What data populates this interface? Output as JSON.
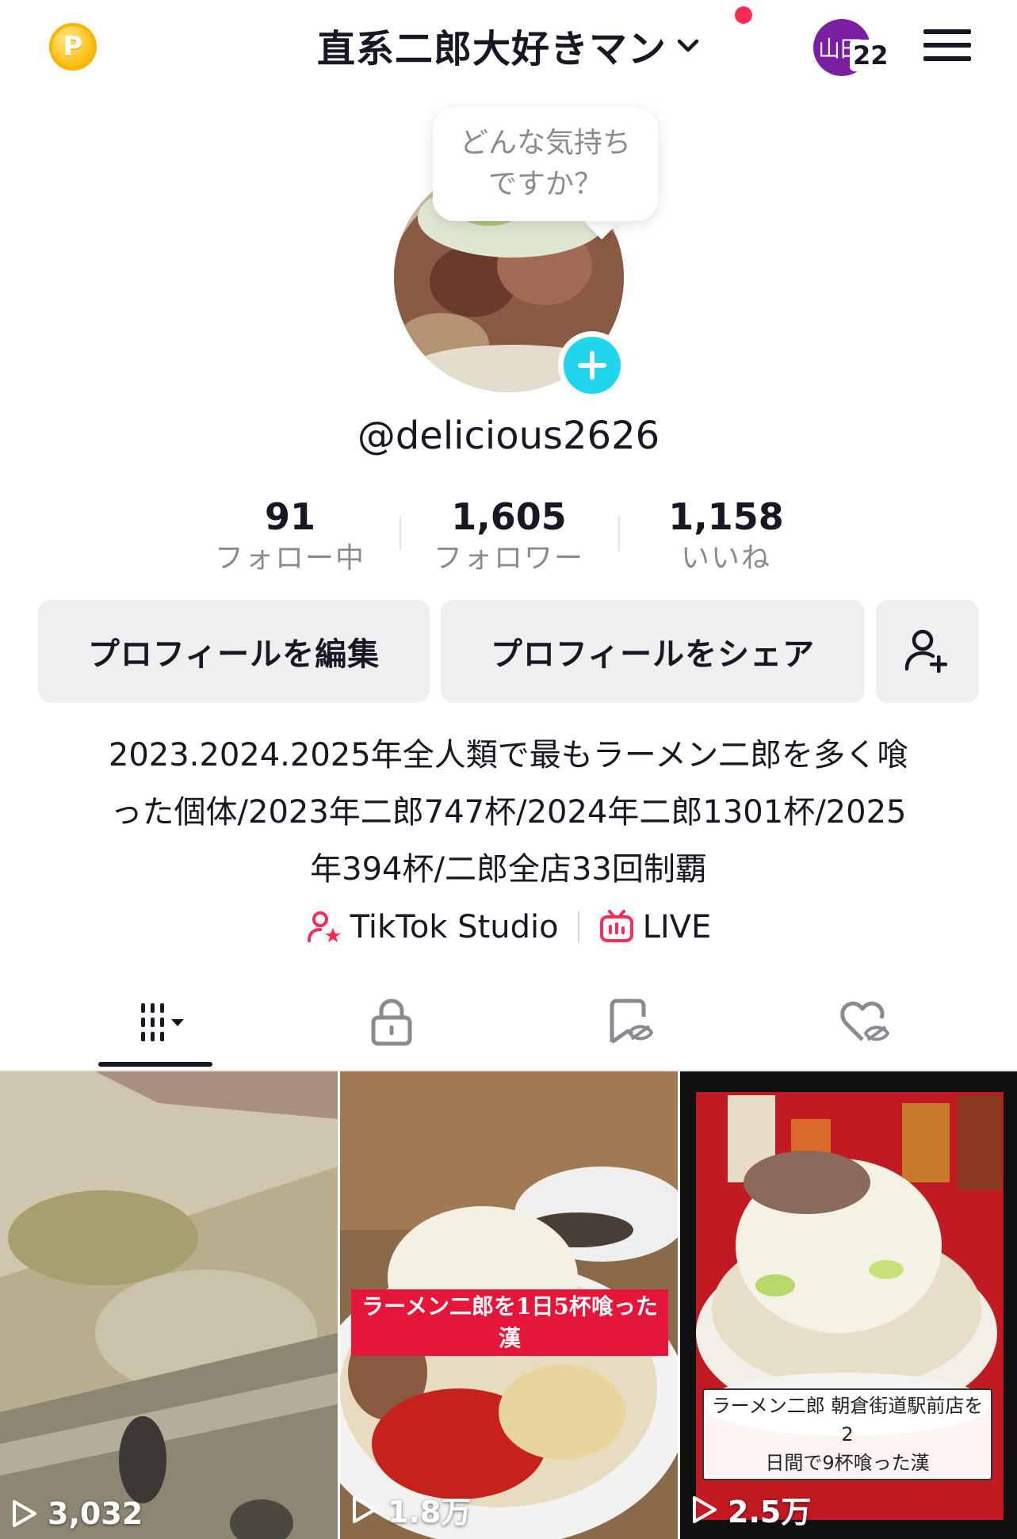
{
  "header": {
    "coin_letter": "P",
    "title": "直系二郎大好きマン",
    "avatar_text": "山田",
    "avatar_count": "22"
  },
  "profile": {
    "bubble_text": "どんな気持ち\nですか？",
    "username": "@delicious2626"
  },
  "stats": [
    {
      "value": "91",
      "label": "フォロー中"
    },
    {
      "value": "1,605",
      "label": "フォロワー"
    },
    {
      "value": "1,158",
      "label": "いいね"
    }
  ],
  "buttons": {
    "edit": "プロフィールを編集",
    "share": "プロフィールをシェア"
  },
  "bio": {
    "line1": "2023.2024.2025年全人類で最もラーメン二郎を多く喰",
    "line2": "った個体/2023年二郎747杯/2024年二郎1301杯/2025",
    "line3": "年394杯/二郎全店33回制覇"
  },
  "links": {
    "studio": "TikTok Studio",
    "live": "LIVE"
  },
  "videos": [
    {
      "views": "3,032"
    },
    {
      "views": "1.8万",
      "caption_line1": "ラーメン二郎を1日5杯喰った",
      "caption_line2": "漢"
    },
    {
      "views": "2.5万",
      "caption_line1": "ラーメン二郎 朝倉街道駅前店を2",
      "caption_line2": "日間で9杯喰った漢"
    }
  ],
  "colors": {
    "accent_red": "#fe2c55",
    "badge_cyan": "#20d5ec",
    "button_bg": "#efeff0",
    "muted_text": "#8a8b91"
  }
}
